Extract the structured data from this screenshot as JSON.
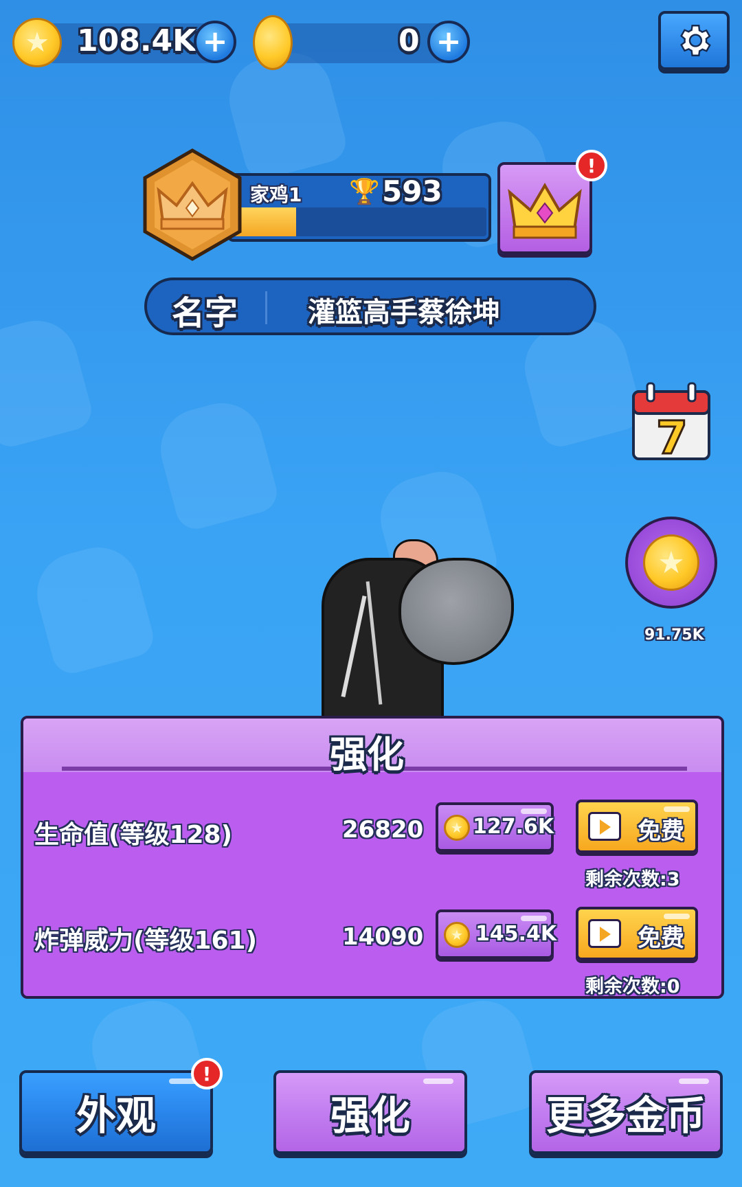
{
  "currency": {
    "gold_amount": "108.4K",
    "gem_amount": "0",
    "add_symbol": "+"
  },
  "rank": {
    "tier_name": "家鸡1",
    "trophies": "593",
    "progress": 0.25
  },
  "name_bar": {
    "label": "名字",
    "player_name": "灌篮高手蔡徐坤"
  },
  "side": {
    "calendar_day": "7",
    "coin_reward": "91.75K"
  },
  "alert_symbol": "!",
  "upgrade_panel": {
    "title": "强化",
    "rows": [
      {
        "label": "生命值(等级128)",
        "value": "26820",
        "cost": "127.6K",
        "free_label": "免费",
        "remaining": "剩余次数:3"
      },
      {
        "label": "炸弹威力(等级161)",
        "value": "14090",
        "cost": "145.4K",
        "free_label": "免费",
        "remaining": "剩余次数:0"
      }
    ]
  },
  "bottom_nav": {
    "appearance": "外观",
    "upgrade": "强化",
    "more_coins": "更多金币"
  },
  "colors": {
    "background": "#3aa3f4",
    "panel": "#bb5ef0",
    "button_blue": "#2a86ec",
    "button_purple": "#c27ef0",
    "gold": "#ffc928",
    "alert": "#e52727"
  }
}
